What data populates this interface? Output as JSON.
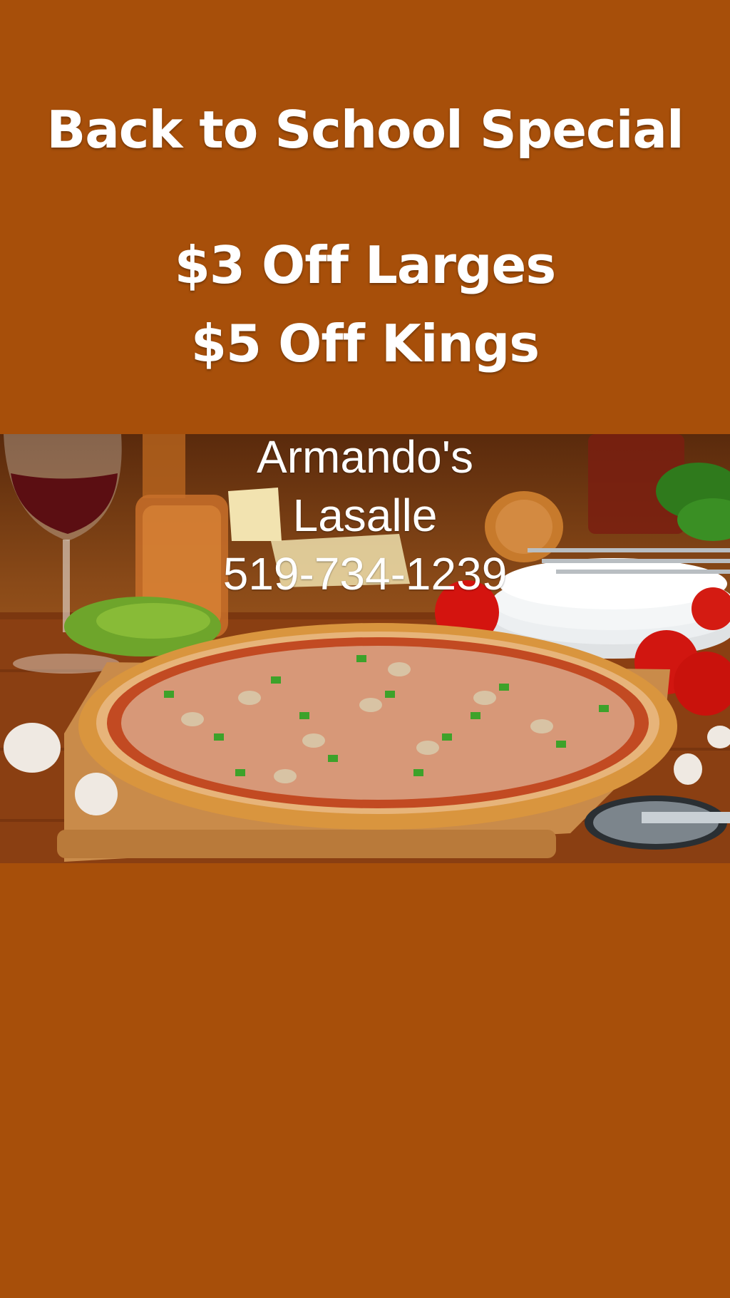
{
  "promo": {
    "title": "Back to School Special",
    "offers": [
      "$3 Off Larges",
      "$5 Off Kings"
    ]
  },
  "store": {
    "name": "Armando's",
    "location": "Lasalle",
    "phone": "519-734-1239"
  },
  "colors": {
    "background": "#a74f0a",
    "text": "#ffffff"
  },
  "image": {
    "subject": "pizza-photo"
  }
}
